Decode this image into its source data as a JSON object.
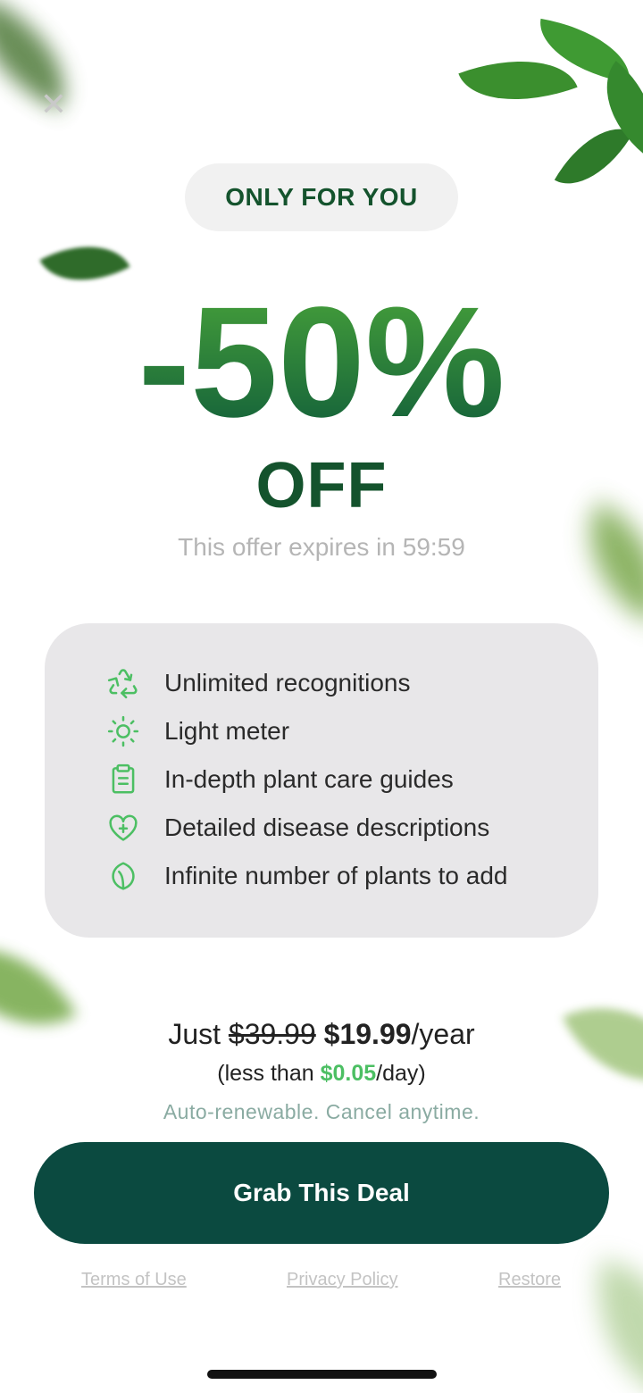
{
  "badge": {
    "label": "ONLY FOR YOU"
  },
  "discount": {
    "value": "-50%",
    "suffix": "OFF"
  },
  "expiry": {
    "text": "This offer expires in 59:59"
  },
  "features": [
    {
      "icon": "recycle-icon",
      "label": "Unlimited recognitions"
    },
    {
      "icon": "sun-icon",
      "label": "Light meter"
    },
    {
      "icon": "clipboard-icon",
      "label": "In-depth plant care guides"
    },
    {
      "icon": "heart-plus-icon",
      "label": "Detailed disease descriptions"
    },
    {
      "icon": "leaf-icon",
      "label": "Infinite number of plants to add"
    }
  ],
  "pricing": {
    "prefix": "Just",
    "old_price": "$39.99",
    "new_price": "$19.99",
    "period": "/year",
    "daily_prefix": "(less than",
    "daily_price": "$0.05",
    "daily_suffix": "/day)",
    "renew_note": "Auto-renewable. Cancel anytime."
  },
  "cta": {
    "label": "Grab This Deal"
  },
  "footer_links": {
    "terms": "Terms of Use",
    "privacy": "Privacy Policy",
    "restore": "Restore"
  },
  "colors": {
    "brand_dark": "#14532d",
    "gradient_top": "#4aa53a",
    "gradient_bottom": "#0e5a3a",
    "cta_bg": "#0b4a40",
    "accent_green": "#4cbf63",
    "panel_bg": "#e8e7e9"
  }
}
